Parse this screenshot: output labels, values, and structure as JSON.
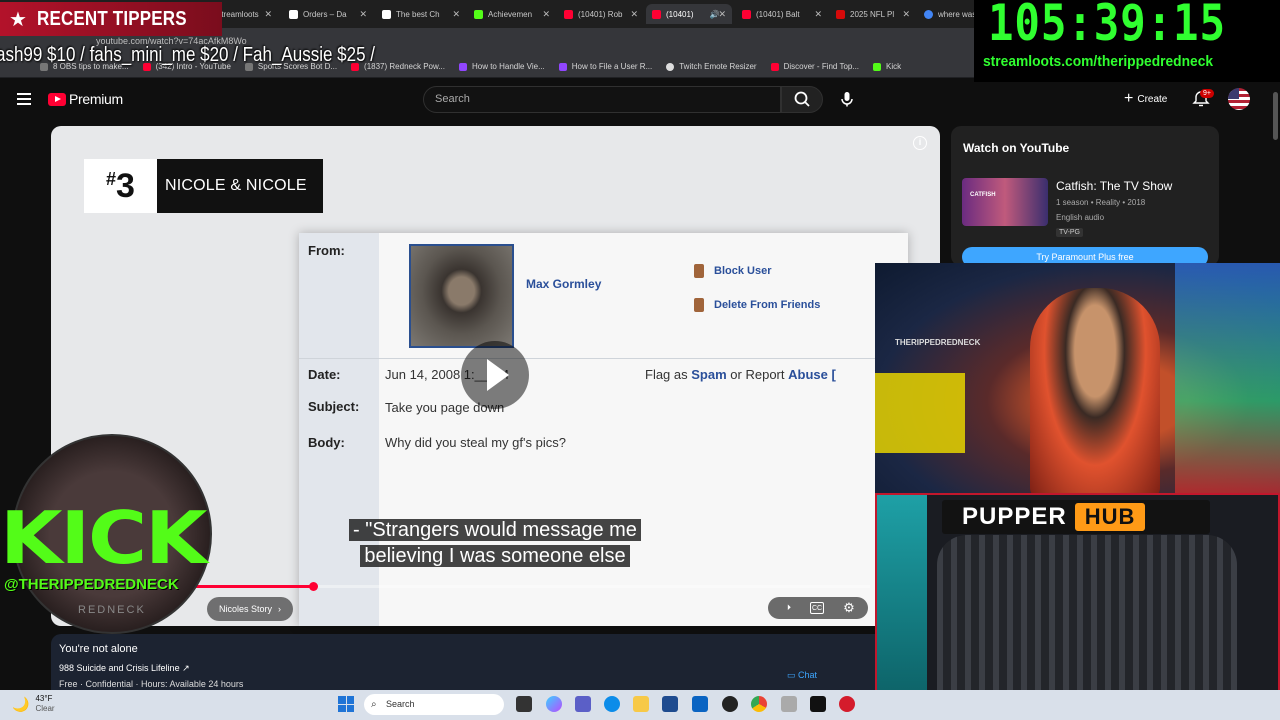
{
  "browser": {
    "tabs": [
      {
        "label": "Streamloots",
        "active": false,
        "color": "#6b46c1"
      },
      {
        "label": "Orders – Da",
        "active": false,
        "color": "#ffffff"
      },
      {
        "label": "The best Ch",
        "active": false,
        "color": "#ffffff"
      },
      {
        "label": "Achievemen",
        "active": false,
        "color": "#53fc18"
      },
      {
        "label": "(10401) Rob",
        "active": false,
        "color": "#ff0033"
      },
      {
        "label": "(10401)",
        "active": true,
        "color": "#ff0033"
      },
      {
        "label": "(10401) Balt",
        "active": false,
        "color": "#ff0033"
      },
      {
        "label": "2025 NFL Pl",
        "active": false,
        "color": "#d50a0a"
      },
      {
        "label": "where was",
        "active": false,
        "color": "#4285f4"
      }
    ],
    "address": "youtube.com/watch?v=74acAfkM8Wo",
    "bookmarks": [
      {
        "label": "8 OBS tips to make...",
        "color": "#777777"
      },
      {
        "label": "(342) Intro - YouTube",
        "color": "#ff0033"
      },
      {
        "label": "Sports Scores Bot D...",
        "color": "#777777"
      },
      {
        "label": "(1837) Redneck Pow...",
        "color": "#ff0033"
      },
      {
        "label": "How to Handle Vie...",
        "color": "#9146ff"
      },
      {
        "label": "How to File a User R...",
        "color": "#9146ff"
      },
      {
        "label": "Twitch Emote Resizer",
        "color": "#dddddd"
      },
      {
        "label": "Discover - Find Top...",
        "color": "#ff0033"
      },
      {
        "label": "Kick",
        "color": "#53fc18"
      }
    ]
  },
  "youtube": {
    "brand": "Premium",
    "search_placeholder": "Search",
    "create_label": "Create",
    "notifications_badge": "9+"
  },
  "video": {
    "rank": "3",
    "rank_symbol": "#",
    "title_card": "NICOLE & NICOLE",
    "message": {
      "from_label": "From:",
      "sender": "Max Gormley",
      "block": "Block User",
      "delete": "Delete From Friends",
      "date_label": "Date:",
      "date_value": "Jun 14, 2008 1:__PM",
      "flag_prefix": "Flag as",
      "flag_spam": "Spam",
      "flag_mid": "or Report",
      "flag_abuse": "Abuse [",
      "subject_label": "Subject:",
      "subject_value": "Take you page down",
      "body_label": "Body:",
      "body_value": "Why did you steal my gf's pics?"
    },
    "caption_line1": "- \"Strangers would message me",
    "caption_line2": "believing I was someone else",
    "chapter_label": "Nicoles Story",
    "progress_fraction": 0.2
  },
  "panel": {
    "heading": "You're not alone",
    "line1": "988 Suicide and Crisis Lifeline ↗",
    "line2": "Free · Confidential · Hours: Available 24 hours",
    "chat": "Chat"
  },
  "sidebar": {
    "heading": "Watch on YouTube",
    "show_title": "Catfish: The TV Show",
    "thumb_text": "CATFISH",
    "meta1": "1 season • Reality • 2018",
    "meta2": "English audio",
    "rating": "TV-PG",
    "cta": "Try Paramount Plus free"
  },
  "overlay": {
    "tippers_title": "RECENT TIPPERS",
    "ticker": "ash99 $10 / fahs_mini_me $20 / Fah_Aussie $25 /",
    "timer": "105:39:15",
    "timer_url": "streamloots.com/therippedredneck",
    "kick_text": "KICK",
    "kick_handle": "@THERIPPEDREDNECK",
    "kick_sub": "REDNECK",
    "cam_label": "THERIPPEDREDNECK",
    "pupper_a": "PUPPER",
    "pupper_b": "HUB"
  },
  "taskbar": {
    "temp": "43°F",
    "condition": "Clear",
    "search": "Search"
  }
}
